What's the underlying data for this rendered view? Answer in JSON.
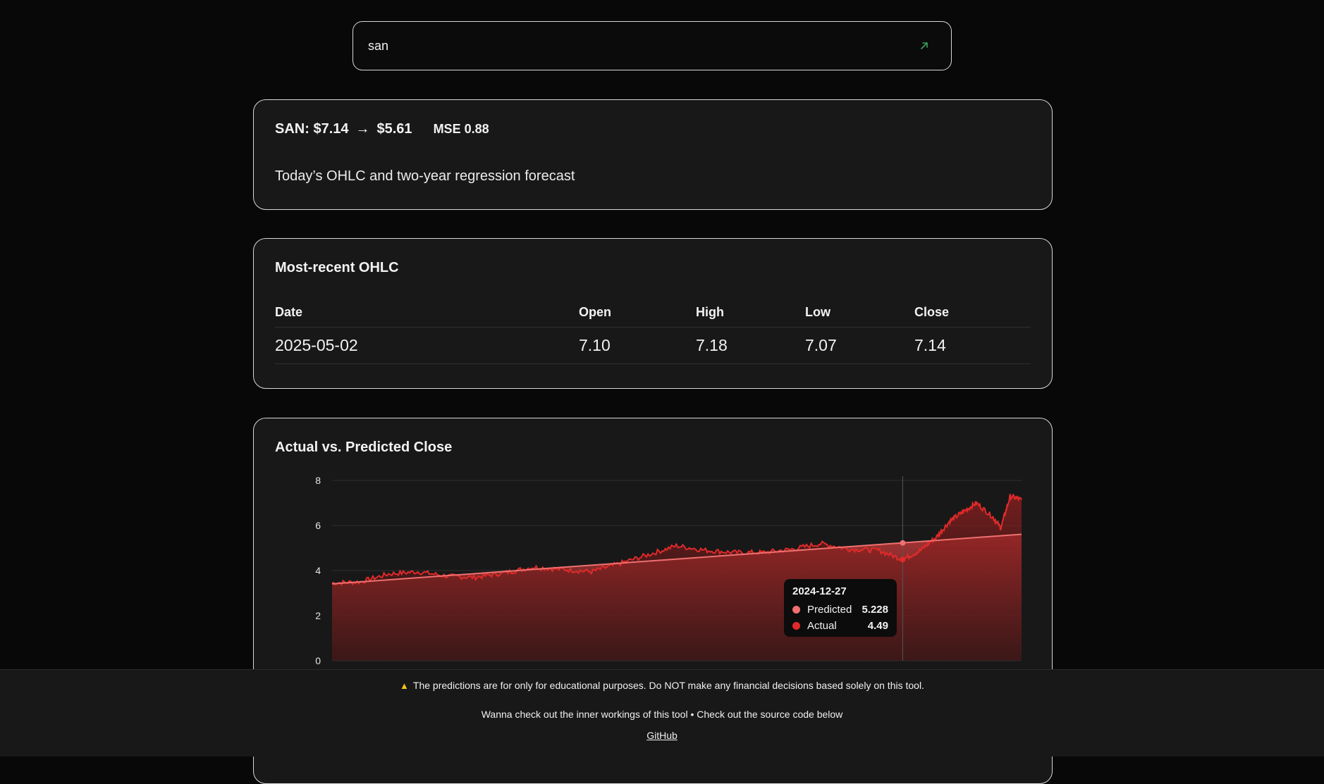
{
  "search": {
    "value": "san",
    "go_icon": "arrow-up-right-icon"
  },
  "header": {
    "ticker_price": "SAN: $7.14",
    "arrow": "→",
    "forecast_price": "$5.61",
    "mse": "MSE 0.88",
    "subtitle": "Today’s OHLC and two-year regression forecast"
  },
  "ohlc": {
    "title": "Most-recent OHLC",
    "columns": [
      "Date",
      "Open",
      "High",
      "Low",
      "Close"
    ],
    "rows": [
      [
        "2025-05-02",
        "7.10",
        "7.18",
        "7.07",
        "7.14"
      ]
    ]
  },
  "chart": {
    "title": "Actual vs. Predicted Close",
    "tooltip": {
      "date": "2024-12-27",
      "rows": [
        {
          "name": "Predicted",
          "value": "5.228",
          "color": "#f07070"
        },
        {
          "name": "Actual",
          "value": "4.49",
          "color": "#e02a2a"
        }
      ]
    }
  },
  "chart_data": {
    "type": "area",
    "title": "Actual vs. Predicted Close",
    "x_range": [
      "2023-05-02",
      "2025-05-02"
    ],
    "ylim": [
      0,
      8
    ],
    "yticks": [
      "0",
      "2",
      "4",
      "6",
      "8"
    ],
    "grid": true,
    "series": [
      {
        "name": "Predicted",
        "color": "#f07070",
        "x": [
          "2023-05-02",
          "2025-05-02"
        ],
        "values": [
          3.41,
          5.61
        ]
      },
      {
        "name": "Actual",
        "color": "#e02a2a",
        "x": [
          "2023-05-02",
          "2023-06-01",
          "2023-07-01",
          "2023-08-01",
          "2023-09-01",
          "2023-10-01",
          "2023-11-01",
          "2023-12-01",
          "2024-01-01",
          "2024-02-01",
          "2024-03-01",
          "2024-04-01",
          "2024-05-01",
          "2024-06-01",
          "2024-07-01",
          "2024-08-01",
          "2024-09-01",
          "2024-10-01",
          "2024-11-01",
          "2024-12-01",
          "2024-12-27",
          "2025-01-15",
          "2025-02-01",
          "2025-02-15",
          "2025-03-01",
          "2025-03-15",
          "2025-04-01",
          "2025-04-10",
          "2025-04-20",
          "2025-05-02"
        ],
        "values": [
          3.45,
          3.5,
          3.85,
          3.95,
          3.75,
          3.7,
          3.9,
          4.15,
          4.05,
          3.95,
          4.3,
          4.7,
          5.1,
          4.9,
          4.8,
          4.8,
          4.95,
          5.2,
          4.95,
          4.9,
          4.49,
          4.9,
          5.5,
          6.2,
          6.6,
          7.0,
          6.4,
          5.9,
          7.3,
          7.14
        ]
      }
    ]
  },
  "footer": {
    "warning_icon": "warning-icon",
    "warning": "The predictions are for only for educational purposes. Do NOT make any financial decisions based solely on this tool.",
    "inner": "Wanna check out the inner workings of this tool • Check out the source code below",
    "link": "GitHub"
  }
}
